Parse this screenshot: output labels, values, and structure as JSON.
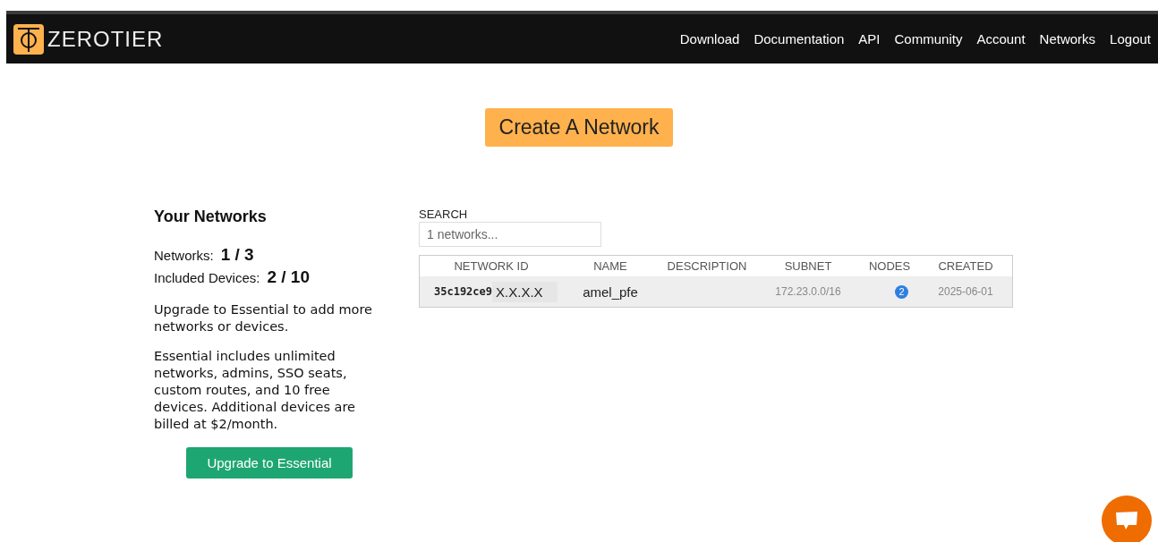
{
  "brand": {
    "name": "ZEROTIER"
  },
  "nav": [
    "Download",
    "Documentation",
    "API",
    "Community",
    "Account",
    "Networks",
    "Logout"
  ],
  "create_button": "Create A Network",
  "sidebar": {
    "title": "Your Networks",
    "stats": [
      {
        "label": "Networks:",
        "value": "1 / 3"
      },
      {
        "label": "Included Devices:",
        "value": "2 / 10"
      }
    ],
    "paragraphs": [
      "Upgrade to Essential to add more networks or devices.",
      "Essential includes unlimited networks, admins, SSO seats, custom routes, and 10 free devices. Additional devices are billed at $2/month."
    ],
    "upgrade_button": "Upgrade to Essential"
  },
  "search": {
    "label": "SEARCH",
    "placeholder": "1 networks..."
  },
  "table": {
    "columns": [
      "NETWORK ID",
      "NAME",
      "DESCRIPTION",
      "SUBNET",
      "NODES",
      "CREATED"
    ],
    "rows": [
      {
        "network_id": "35c192ce9",
        "network_id_masked": "X.X.X.X",
        "name": "amel_pfe",
        "subnet": "172.23.0.0/16",
        "nodes": "2",
        "created": "2025-06-01"
      }
    ]
  }
}
